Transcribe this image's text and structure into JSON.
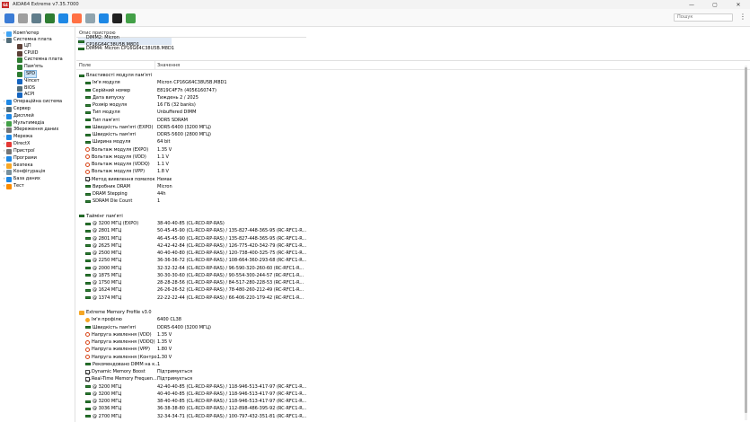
{
  "window": {
    "title": "AIDA64 Extreme v7.35.7000",
    "logo_text": "64",
    "controls": [
      "—",
      "▢",
      "✕"
    ]
  },
  "toolbar": {
    "buttons": [
      {
        "name": "refresh-icon",
        "color": "#3a7bd5"
      },
      {
        "name": "report-icon",
        "color": "#9e9e9e"
      },
      {
        "name": "motherboard-icon",
        "color": "#607d8b"
      },
      {
        "name": "memory-icon",
        "color": "#2e7d32"
      },
      {
        "name": "network-icon",
        "color": "#1e88e5"
      },
      {
        "name": "flame-icon",
        "color": "#ff7043"
      },
      {
        "name": "hardware-icon",
        "color": "#90a4ae"
      },
      {
        "name": "user-icon",
        "color": "#1e88e5"
      },
      {
        "name": "benchmark-icon",
        "color": "#212121"
      },
      {
        "name": "stability-icon",
        "color": "#43a047"
      }
    ],
    "search_placeholder": "Пошук"
  },
  "tree": {
    "items": [
      {
        "label": "Комп'ютер",
        "depth": 0,
        "expander": "›",
        "icon_color": "#42a5f5"
      },
      {
        "label": "Системна плата",
        "depth": 0,
        "expander": "⌄",
        "icon_color": "#546e7a"
      },
      {
        "label": "ЦП",
        "depth": 1,
        "expander": "",
        "icon_color": "#5d4037"
      },
      {
        "label": "CPUID",
        "depth": 1,
        "expander": "",
        "icon_color": "#5d4037"
      },
      {
        "label": "Системна плата",
        "depth": 1,
        "expander": "",
        "icon_color": "#2e7d32"
      },
      {
        "label": "Пам'ять",
        "depth": 1,
        "expander": "",
        "icon_color": "#2e7d32"
      },
      {
        "label": "SPD",
        "depth": 1,
        "expander": "",
        "icon_color": "#2e7d32",
        "selected": true
      },
      {
        "label": "Чіпсет",
        "depth": 1,
        "expander": "",
        "icon_color": "#1565c0"
      },
      {
        "label": "BIOS",
        "depth": 1,
        "expander": "",
        "icon_color": "#546e7a"
      },
      {
        "label": "ACPI",
        "depth": 1,
        "expander": "",
        "icon_color": "#1565c0"
      },
      {
        "label": "Операційна система",
        "depth": 0,
        "expander": "›",
        "icon_color": "#1e88e5"
      },
      {
        "label": "Сервер",
        "depth": 0,
        "expander": "›",
        "icon_color": "#546e7a"
      },
      {
        "label": "Дисплей",
        "depth": 0,
        "expander": "›",
        "icon_color": "#1e88e5"
      },
      {
        "label": "Мультимедіа",
        "depth": 0,
        "expander": "›",
        "icon_color": "#43a047"
      },
      {
        "label": "Збереження даних",
        "depth": 0,
        "expander": "›",
        "icon_color": "#757575"
      },
      {
        "label": "Мережа",
        "depth": 0,
        "expander": "›",
        "icon_color": "#1e88e5"
      },
      {
        "label": "DirectX",
        "depth": 0,
        "expander": "›",
        "icon_color": "#e53935"
      },
      {
        "label": "Пристрої",
        "depth": 0,
        "expander": "›",
        "icon_color": "#757575"
      },
      {
        "label": "Програми",
        "depth": 0,
        "expander": "›",
        "icon_color": "#1e88e5"
      },
      {
        "label": "Безпека",
        "depth": 0,
        "expander": "›",
        "icon_color": "#f9a825"
      },
      {
        "label": "Конфігурація",
        "depth": 0,
        "expander": "›",
        "icon_color": "#78909c"
      },
      {
        "label": "База даних",
        "depth": 0,
        "expander": "›",
        "icon_color": "#1e88e5"
      },
      {
        "label": "Тест",
        "depth": 0,
        "expander": "›",
        "icon_color": "#fb8c00"
      }
    ]
  },
  "devices": {
    "header": "Опис пристрою",
    "items": [
      {
        "label": "DIMM2: Micron CP16G64C38U5B.M8D1",
        "selected": true
      },
      {
        "label": "DIMM4: Micron CP16G64C38U5B.M8D1",
        "selected": false
      }
    ]
  },
  "details": {
    "col_field": "Поле",
    "col_value": "Значення",
    "rows": [
      {
        "kind": "section",
        "icon": "chip",
        "field": "Властивості модуля пам'яті",
        "value": ""
      },
      {
        "kind": "item",
        "icon": "chip",
        "field": "Ім'я модуля",
        "value": "Micron CP16G64C38U5B.M8D1"
      },
      {
        "kind": "item",
        "icon": "chip",
        "field": "Серійний номер",
        "value": "E819C4F7h (4056160747)"
      },
      {
        "kind": "item",
        "icon": "chip",
        "field": "Дата випуску",
        "value": "Тиждень 2 / 2025"
      },
      {
        "kind": "item",
        "icon": "chip",
        "field": "Розмір модуля",
        "value": "16 ГБ (32 banks)"
      },
      {
        "kind": "item",
        "icon": "chip",
        "field": "Тип модуля",
        "value": "Unbuffered DIMM"
      },
      {
        "kind": "item",
        "icon": "chip",
        "field": "Тип пам'яті",
        "value": "DDR5 SDRAM"
      },
      {
        "kind": "item",
        "icon": "chip",
        "field": "Швидкість пам'яті (EXPO)",
        "value": "DDR5-6400 (3200 МГЦ)"
      },
      {
        "kind": "item",
        "icon": "chip",
        "field": "Швидкість пам'яті",
        "value": "DDR5-5600 (2800 МГЦ)"
      },
      {
        "kind": "item",
        "icon": "chip",
        "field": "Ширина модуля",
        "value": "64 bit"
      },
      {
        "kind": "item",
        "icon": "bolt",
        "field": "Вольтаж модуля (EXPO)",
        "value": "1.35 V"
      },
      {
        "kind": "item",
        "icon": "bolt",
        "field": "Вольтаж модуля (VDD)",
        "value": "1.1 V"
      },
      {
        "kind": "item",
        "icon": "bolt",
        "field": "Вольтаж модуля (VDDQ)",
        "value": "1.1 V"
      },
      {
        "kind": "item",
        "icon": "bolt",
        "field": "Вольтаж модуля (VPP)",
        "value": "1.8 V"
      },
      {
        "kind": "item",
        "icon": "check",
        "field": "Метод виявлення помилок",
        "value": "Немає"
      },
      {
        "kind": "item",
        "icon": "chip",
        "field": "Виробник DRAM",
        "value": "Micron"
      },
      {
        "kind": "item",
        "icon": "chip",
        "field": "DRAM Stepping",
        "value": "44h"
      },
      {
        "kind": "item",
        "icon": "chip",
        "field": "SDRAM Die Count",
        "value": "1"
      },
      {
        "kind": "blank",
        "icon": "",
        "field": "",
        "value": ""
      },
      {
        "kind": "section",
        "icon": "chip",
        "field": "Таймінг пам'яті",
        "value": ""
      },
      {
        "kind": "item",
        "icon": "chip",
        "field": "@ 3200 МГЦ (EXPO)",
        "value": "38-40-40-85  (CL-RCD-RP-RAS)"
      },
      {
        "kind": "item",
        "icon": "chip",
        "field": "@ 2801 МГЦ",
        "value": "50-45-45-90  (CL-RCD-RP-RAS) / 135-827-448-365-95  (RC-RFC1-R..."
      },
      {
        "kind": "item",
        "icon": "chip",
        "field": "@ 2801 МГЦ",
        "value": "46-45-45-90  (CL-RCD-RP-RAS) / 135-827-448-365-95  (RC-RFC1-R..."
      },
      {
        "kind": "item",
        "icon": "chip",
        "field": "@ 2625 МГЦ",
        "value": "42-42-42-84  (CL-RCD-RP-RAS) / 126-775-420-342-79  (RC-RFC1-R..."
      },
      {
        "kind": "item",
        "icon": "chip",
        "field": "@ 2500 МГЦ",
        "value": "40-40-40-80  (CL-RCD-RP-RAS) / 120-738-400-325-75  (RC-RFC1-R..."
      },
      {
        "kind": "item",
        "icon": "chip",
        "field": "@ 2250 МГЦ",
        "value": "36-36-36-72  (CL-RCD-RP-RAS) / 108-664-360-293-68  (RC-RFC1-R..."
      },
      {
        "kind": "item",
        "icon": "chip",
        "field": "@ 2000 МГЦ",
        "value": "32-32-32-64  (CL-RCD-RP-RAS) / 96-590-320-260-60  (RC-RFC1-R..."
      },
      {
        "kind": "item",
        "icon": "chip",
        "field": "@ 1875 МГЦ",
        "value": "30-30-30-60  (CL-RCD-RP-RAS) / 90-554-300-244-57  (RC-RFC1-R..."
      },
      {
        "kind": "item",
        "icon": "chip",
        "field": "@ 1750 МГЦ",
        "value": "28-28-28-56  (CL-RCD-RP-RAS) / 84-517-280-228-53  (RC-RFC1-R..."
      },
      {
        "kind": "item",
        "icon": "chip",
        "field": "@ 1624 МГЦ",
        "value": "26-26-26-52  (CL-RCD-RP-RAS) / 78-480-260-212-49  (RC-RFC1-R..."
      },
      {
        "kind": "item",
        "icon": "chip",
        "field": "@ 1374 МГЦ",
        "value": "22-22-22-44  (CL-RCD-RP-RAS) / 66-406-220-179-42  (RC-RFC1-R..."
      },
      {
        "kind": "blank",
        "icon": "",
        "field": "",
        "value": ""
      },
      {
        "kind": "section",
        "icon": "xmp",
        "field": "Extreme Memory Profile v3.0",
        "value": ""
      },
      {
        "kind": "item",
        "icon": "name",
        "field": "Ім'я профілю",
        "value": "6400 CL38"
      },
      {
        "kind": "item",
        "icon": "chip",
        "field": "Швидкість пам'яті",
        "value": "DDR5-6400 (3200 МГЦ)"
      },
      {
        "kind": "item",
        "icon": "bolt",
        "field": "Напруга живлення (VDD)",
        "value": "1.35 V"
      },
      {
        "kind": "item",
        "icon": "bolt",
        "field": "Напруга живлення (VDDQ)",
        "value": "1.35 V"
      },
      {
        "kind": "item",
        "icon": "bolt",
        "field": "Напруга живлення (VPP)",
        "value": "1.80 V"
      },
      {
        "kind": "item",
        "icon": "bolt",
        "field": "Напруга живлення (Контро...",
        "value": "1.30 V"
      },
      {
        "kind": "item",
        "icon": "chip",
        "field": "Рекомендовано DIMM на к...",
        "value": "1"
      },
      {
        "kind": "item",
        "icon": "check",
        "field": "Dynamic Memory Boost",
        "value": "Підтримується"
      },
      {
        "kind": "item",
        "icon": "check",
        "field": "Real-Time Memory Frequen...",
        "value": "Підтримується"
      },
      {
        "kind": "item",
        "icon": "chip",
        "field": "@ 3200 МГЦ",
        "value": "42-40-40-85  (CL-RCD-RP-RAS) / 118-946-513-417-97  (RC-RFC1-R..."
      },
      {
        "kind": "item",
        "icon": "chip",
        "field": "@ 3200 МГЦ",
        "value": "40-40-40-85  (CL-RCD-RP-RAS) / 118-946-513-417-97  (RC-RFC1-R..."
      },
      {
        "kind": "item",
        "icon": "chip",
        "field": "@ 3200 МГЦ",
        "value": "38-40-40-85  (CL-RCD-RP-RAS) / 118-946-513-417-97  (RC-RFC1-R..."
      },
      {
        "kind": "item",
        "icon": "chip",
        "field": "@ 3036 МГЦ",
        "value": "36-38-38-80  (CL-RCD-RP-RAS) / 112-898-486-395-92  (RC-RFC1-R..."
      },
      {
        "kind": "item",
        "icon": "chip",
        "field": "@ 2700 МГЦ",
        "value": "32-34-34-71  (CL-RCD-RP-RAS) / 100-797-432-351-81  (RC-RFC1-R..."
      }
    ]
  }
}
